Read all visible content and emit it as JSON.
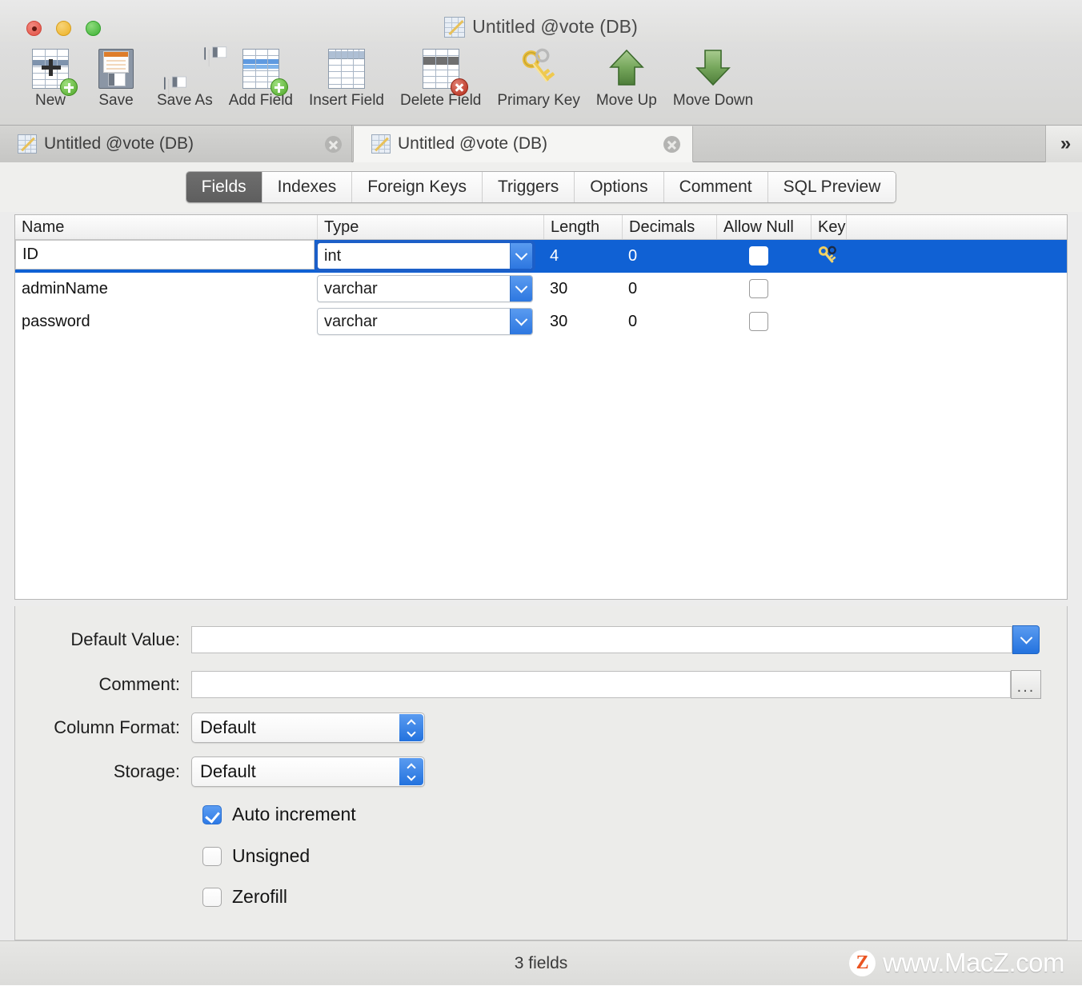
{
  "window": {
    "title": "Untitled @vote (DB)",
    "traffic_lights": [
      "close",
      "minimize",
      "maximize"
    ]
  },
  "toolbar": {
    "items": [
      {
        "label": "New",
        "icon": "new-table-icon"
      },
      {
        "label": "Save",
        "icon": "save-floppy-icon"
      },
      {
        "label": "Save As",
        "icon": "save-as-floppy-icon"
      },
      {
        "label": "Add Field",
        "icon": "add-field-icon"
      },
      {
        "label": "Insert Field",
        "icon": "insert-field-icon"
      },
      {
        "label": "Delete Field",
        "icon": "delete-field-icon"
      },
      {
        "label": "Primary Key",
        "icon": "key-icon"
      },
      {
        "label": "Move Up",
        "icon": "arrow-up-icon"
      },
      {
        "label": "Move Down",
        "icon": "arrow-down-icon"
      }
    ]
  },
  "document_tabs": {
    "items": [
      {
        "label": "Untitled @vote (DB)",
        "active": false
      },
      {
        "label": "Untitled @vote (DB)",
        "active": true
      }
    ],
    "overflow_glyph": "»"
  },
  "segmented_tabs": {
    "items": [
      {
        "label": "Fields",
        "active": true
      },
      {
        "label": "Indexes",
        "active": false
      },
      {
        "label": "Foreign Keys",
        "active": false
      },
      {
        "label": "Triggers",
        "active": false
      },
      {
        "label": "Options",
        "active": false
      },
      {
        "label": "Comment",
        "active": false
      },
      {
        "label": "SQL Preview",
        "active": false
      }
    ]
  },
  "field_grid": {
    "columns": [
      "Name",
      "Type",
      "Length",
      "Decimals",
      "Allow Null",
      "Key"
    ],
    "rows": [
      {
        "name": "ID",
        "type": "int",
        "length": "4",
        "decimals": "0",
        "allow_null": false,
        "key": "primary-key-icon",
        "selected": true,
        "editing_name": true
      },
      {
        "name": "adminName",
        "type": "varchar",
        "length": "30",
        "decimals": "0",
        "allow_null": false,
        "key": "",
        "selected": false,
        "editing_name": false
      },
      {
        "name": "password",
        "type": "varchar",
        "length": "30",
        "decimals": "0",
        "allow_null": false,
        "key": "",
        "selected": false,
        "editing_name": false
      }
    ]
  },
  "detail_panel": {
    "default_value": {
      "label": "Default Value:",
      "value": "",
      "placeholder": ""
    },
    "comment": {
      "label": "Comment:",
      "value": "",
      "placeholder": ""
    },
    "column_format": {
      "label": "Column Format:",
      "value": "Default"
    },
    "storage": {
      "label": "Storage:",
      "value": "Default"
    },
    "checkboxes": [
      {
        "label": "Auto increment",
        "checked": true
      },
      {
        "label": "Unsigned",
        "checked": false
      },
      {
        "label": "Zerofill",
        "checked": false
      }
    ],
    "ellipsis_label": "..."
  },
  "status_bar": {
    "text": "3 fields",
    "watermark_logo": "Z",
    "watermark_text": "www.MacZ.com"
  },
  "colors": {
    "selection_blue": "#1061d4",
    "accent_blue": "#2d77e0",
    "toolbar_gray": "#d6d6d4",
    "panel_gray": "#ececea",
    "active_segment": "#6e6e6e",
    "key_gold": "#e8c15a",
    "watermark_orange": "#ea5421"
  }
}
